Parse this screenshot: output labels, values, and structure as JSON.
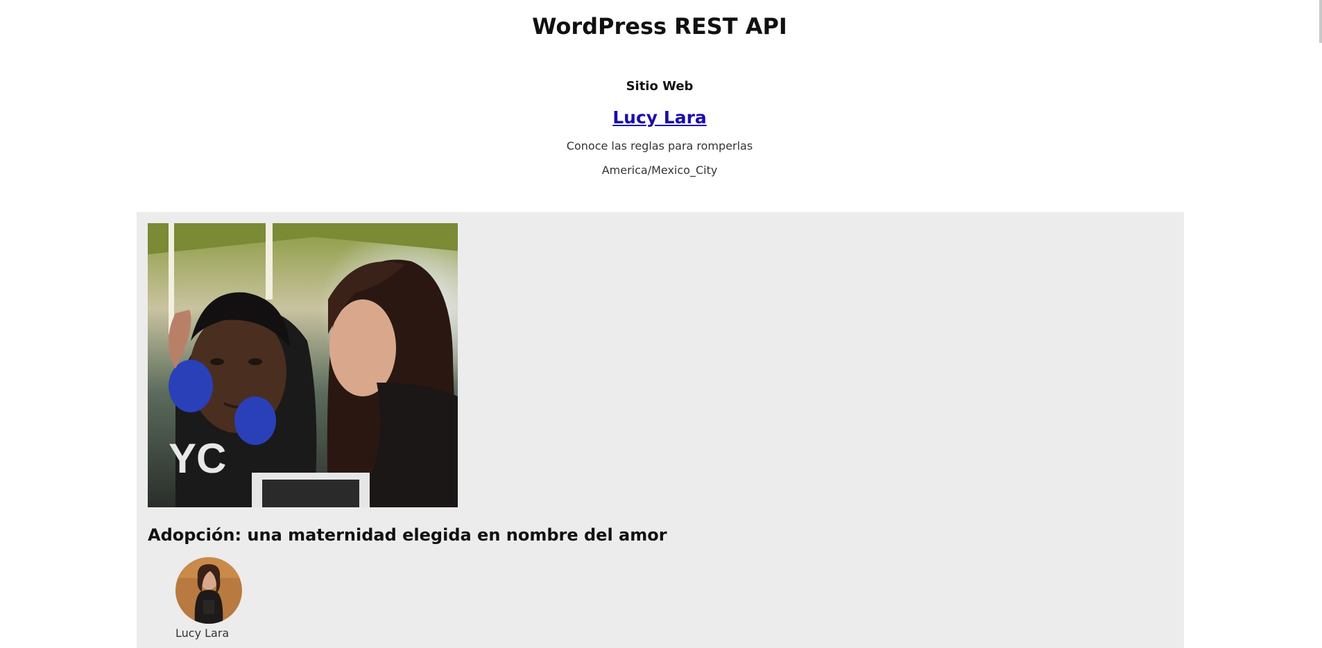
{
  "page": {
    "title": "WordPress REST API"
  },
  "site": {
    "label": "Sitio Web",
    "name": "Lucy Lara",
    "description": "Conoce las reglas para romperlas",
    "timezone": "America/Mexico_City"
  },
  "posts": [
    {
      "title": "Adopción: una maternidad elegida en nombre del amor",
      "image": "photo-couple-selfie",
      "author": {
        "name": "Lucy Lara",
        "avatar": "author-avatar-photo"
      }
    }
  ],
  "colors": {
    "card_background": "#ececec",
    "link": "#1a0dab",
    "text": "#111111"
  }
}
